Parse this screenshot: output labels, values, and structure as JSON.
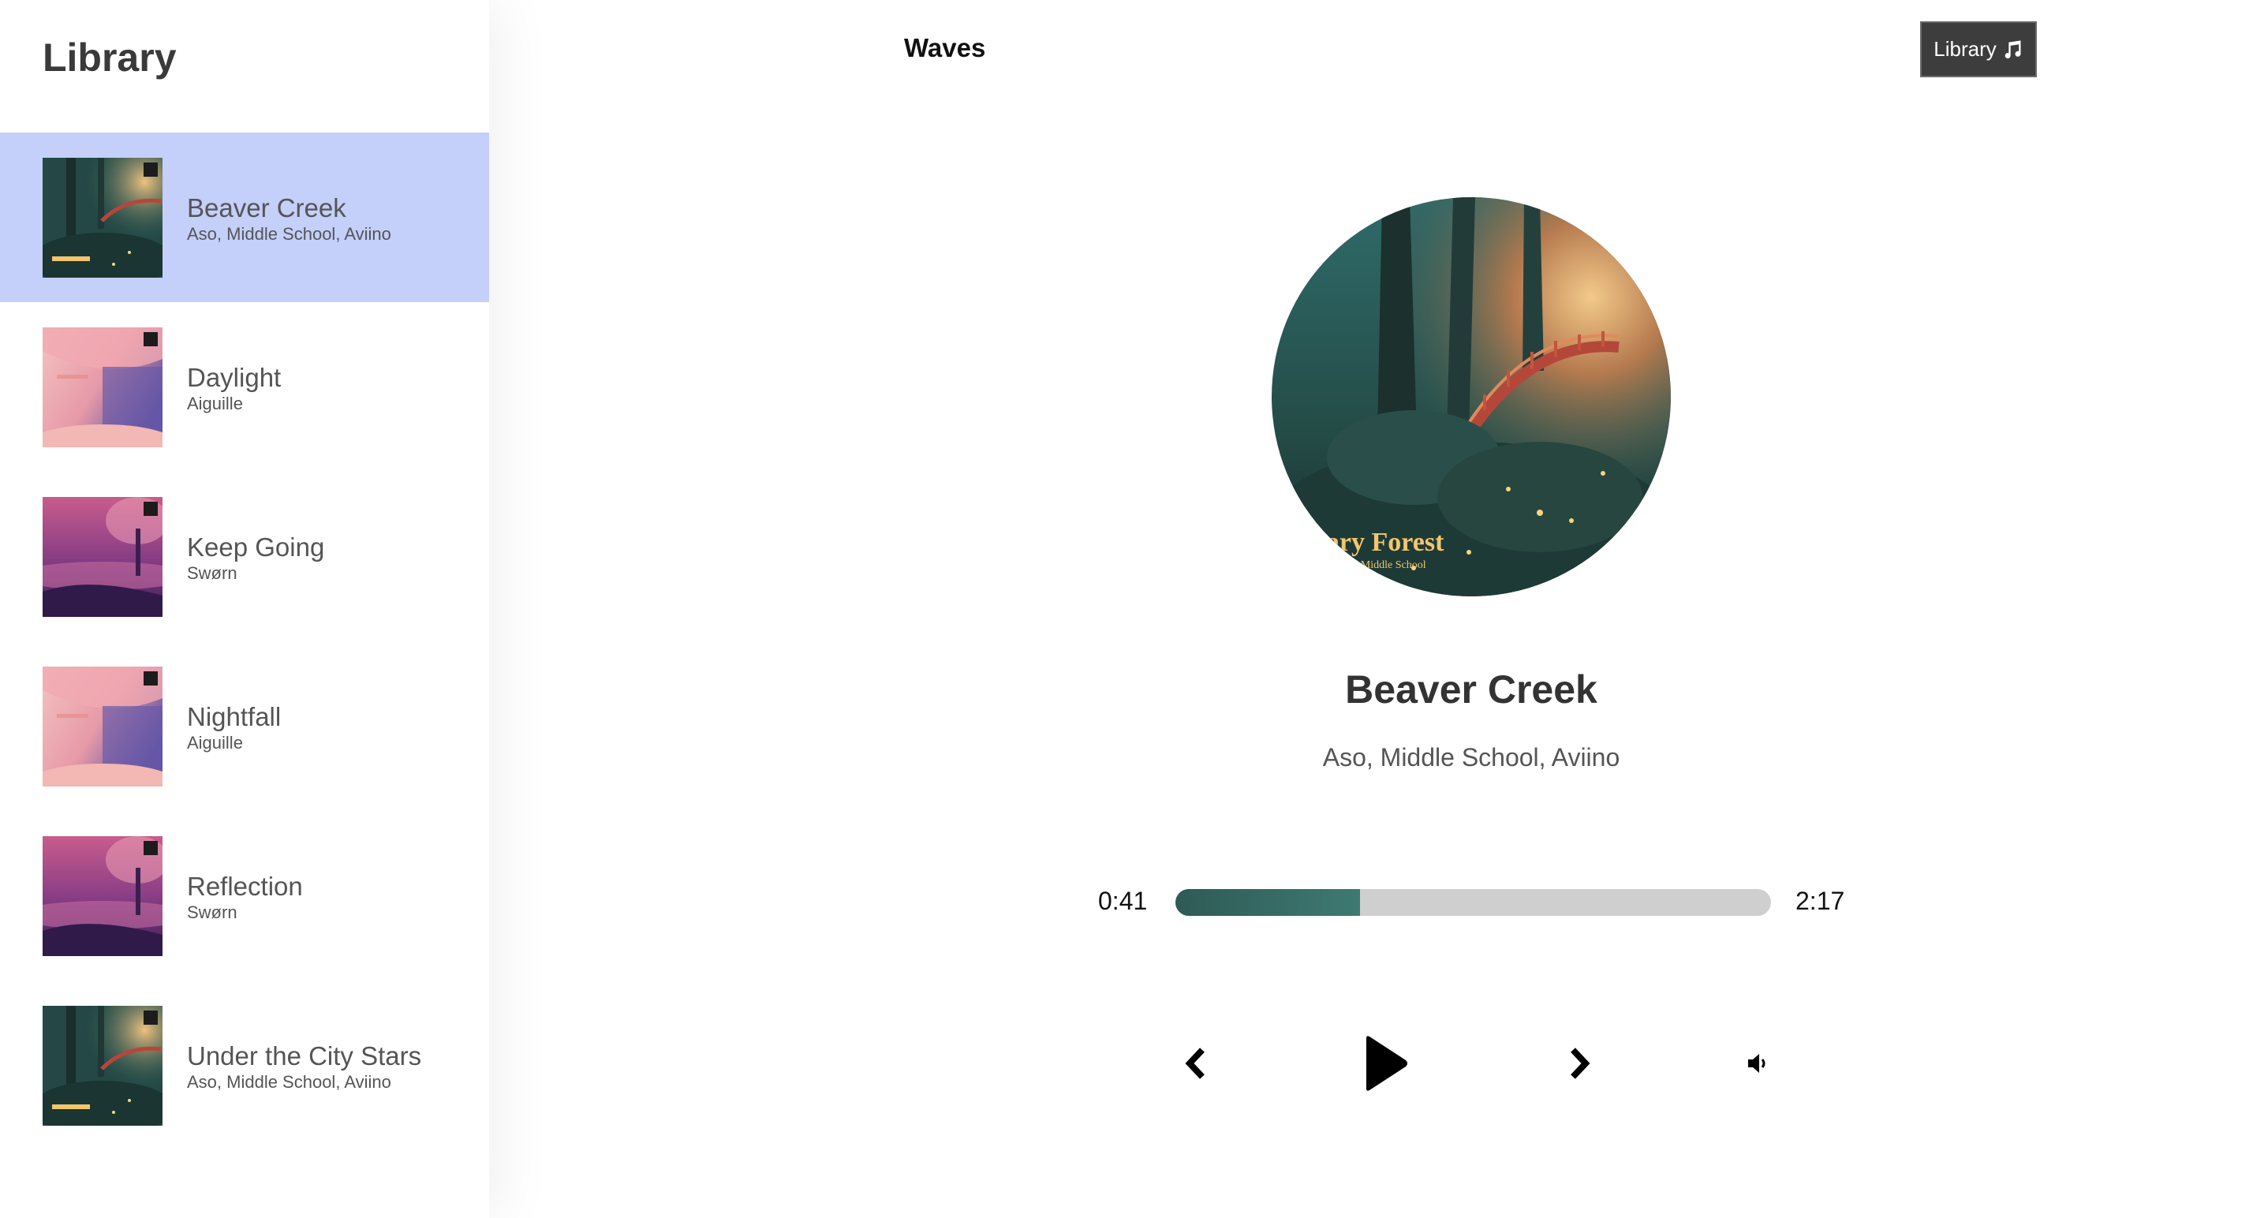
{
  "sidebar": {
    "title": "Library",
    "songs": [
      {
        "name": "Beaver Creek",
        "artist": "Aso, Middle School, Aviino",
        "art": "forest",
        "active": true
      },
      {
        "name": "Daylight",
        "artist": "Aiguille",
        "art": "pink",
        "active": false
      },
      {
        "name": "Keep Going",
        "artist": "Swørn",
        "art": "purple",
        "active": false
      },
      {
        "name": "Nightfall",
        "artist": "Aiguille",
        "art": "pink",
        "active": false
      },
      {
        "name": "Reflection",
        "artist": "Swørn",
        "art": "purple",
        "active": false
      },
      {
        "name": "Under the City Stars",
        "artist": "Aso, Middle School, Aviino",
        "art": "forest",
        "active": false
      }
    ]
  },
  "header": {
    "brand": "Waves",
    "library_button": "Library"
  },
  "player": {
    "title": "Beaver Creek",
    "artist": "Aso, Middle School, Aviino",
    "current_time": "0:41",
    "total_time": "2:17",
    "progress": 0.31,
    "cover_text_line1": "nary Forest",
    "cover_text_line2": "viino x Middle School"
  },
  "icons": {
    "library_button": "music-note-icon",
    "previous": "chevron-left-icon",
    "play": "play-icon",
    "next": "chevron-right-icon",
    "volume": "volume-icon"
  },
  "colors": {
    "active_row": "#c4cffa",
    "progress_fill": "#2e5a55",
    "progress_track": "#cfcfcf",
    "button_bg": "#3d3d3d"
  }
}
